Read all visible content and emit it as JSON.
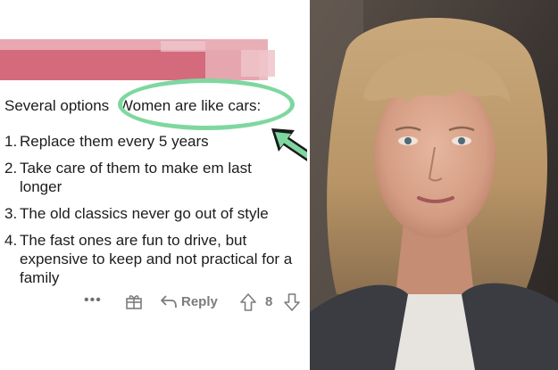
{
  "comment": {
    "intro_prefix": "Several options",
    "intro_highlight": "Women are like cars:",
    "items": [
      {
        "num": "1.",
        "text": "Replace them every 5 years"
      },
      {
        "num": "2.",
        "text": "Take care of them to make em last longer"
      },
      {
        "num": "3.",
        "text": "The old classics never go out of style"
      },
      {
        "num": "4.",
        "text": "The fast ones are fun to drive, but expensive to keep and not practical for a family"
      }
    ]
  },
  "actions": {
    "more_label": "•••",
    "reply_label": "Reply",
    "score": "8"
  },
  "colors": {
    "highlight": "#7fd7a0",
    "redaction": "#d46b7c",
    "meta_text": "#7c7c7c"
  },
  "icons": [
    "gift-icon",
    "reply-arrow-icon",
    "upvote-icon",
    "downvote-icon",
    "annotation-arrow-icon"
  ]
}
